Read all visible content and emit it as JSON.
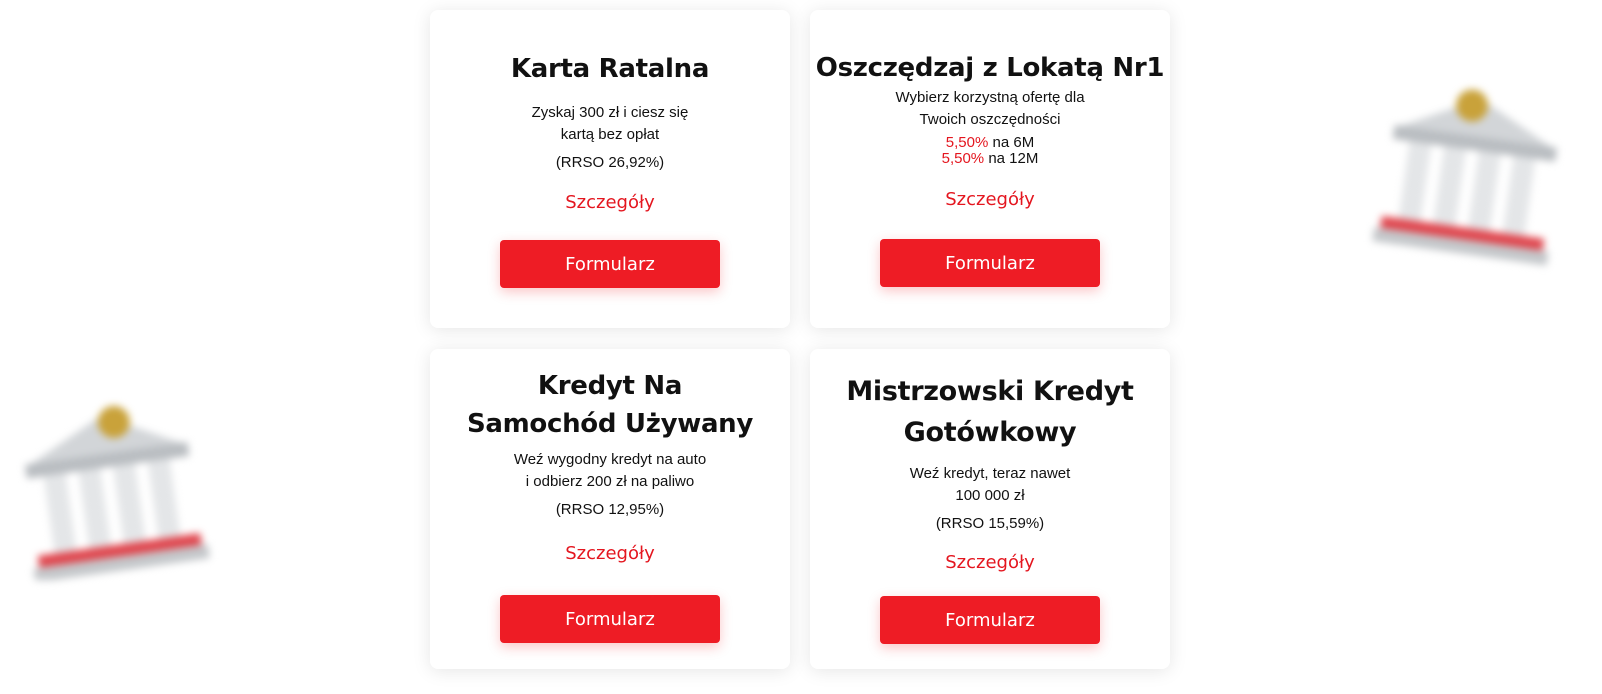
{
  "cards": [
    {
      "title_line1": "Karta Ratalna",
      "desc_line1": "Zyskaj 300 zł i ciesz się",
      "desc_line2": "kartą bez opłat",
      "rrso": "(RRSO 26,92%)",
      "details_label": "Szczegóły",
      "button_label": "Formularz"
    },
    {
      "title_line1": "Oszczędzaj z Lokatą Nr1",
      "desc_line1": "Wybierz korzystną ofertę dla",
      "desc_line2": "Twoich oszczędności",
      "rates": [
        {
          "pct": "5,50%",
          "term": "na 6M"
        },
        {
          "pct": "5,50%",
          "term": "na 12M"
        }
      ],
      "details_label": "Szczegóły",
      "button_label": "Formularz"
    },
    {
      "title_line1": "Kredyt Na",
      "title_line2": "Samochód Używany",
      "desc_line1": "Weź wygodny kredyt na auto",
      "desc_line2": "i odbierz 200 zł na paliwo",
      "rrso": "(RRSO 12,95%)",
      "details_label": "Szczegóły",
      "button_label": "Formularz"
    },
    {
      "title_line1": "Mistrzowski Kredyt",
      "title_line2": "Gotówkowy",
      "desc_line1": "Weź kredyt, teraz nawet",
      "desc_line2": "100 000 zł",
      "rrso": "(RRSO 15,59%)",
      "details_label": "Szczegóły",
      "button_label": "Formularz"
    }
  ],
  "colors": {
    "accent": "#ee1c25",
    "highlight_text": "#e4161f",
    "card_bg": "#ffffff",
    "decor_gray": "#bfc3c7",
    "decor_red": "#e0444c",
    "decor_gold": "#c9a23a"
  },
  "icons": {
    "decor": "bank-building-icon"
  }
}
